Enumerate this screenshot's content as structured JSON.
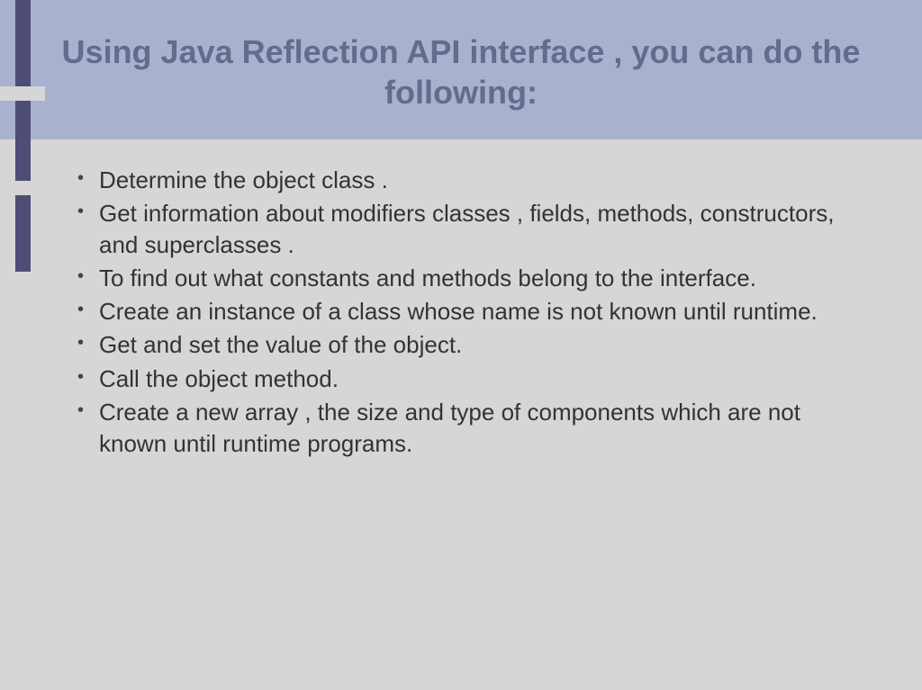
{
  "title": "Using Java Reflection API interface , you can do the following:",
  "bullets": [
    "Determine the object class .",
    "Get information about modifiers classes , fields, methods, constructors, and superclasses .",
    "To find out what constants and methods belong to the interface.",
    "Create an instance of a class whose name is not known until runtime.",
    "Get and set the value of the object.",
    "Call the object method.",
    "Create a new array , the size and type of components which are not known until runtime programs."
  ]
}
